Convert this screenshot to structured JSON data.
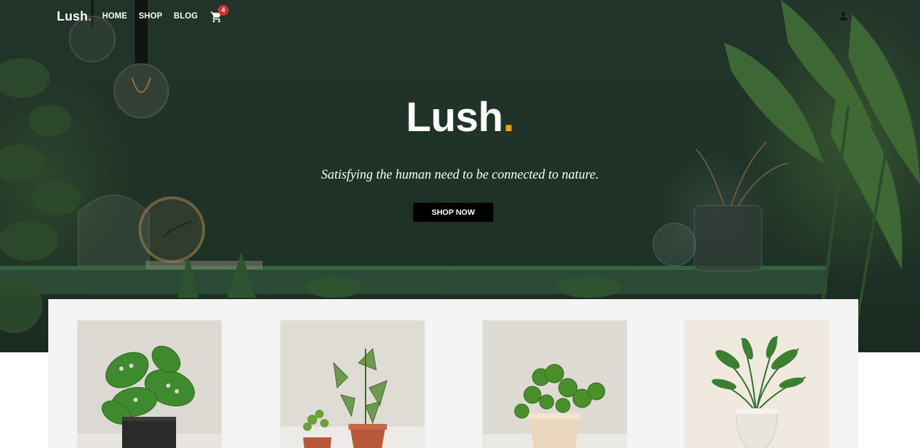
{
  "nav": {
    "logo_text": "Lush",
    "logo_dot": ".",
    "links": [
      "HOME",
      "SHOP",
      "BLOG"
    ],
    "cart_count": "4",
    "cart_icon": "cart-icon",
    "user_icon": "user-icon"
  },
  "hero": {
    "title": "Lush",
    "title_dot": ".",
    "subtitle": "Satisfying the human need to be connected to nature.",
    "button": "SHOP NOW"
  },
  "products": [
    {
      "name": "monstera-adansonii",
      "pot": "black"
    },
    {
      "name": "syngonium-and-fern",
      "pot": "terracotta"
    },
    {
      "name": "pilea-peperomioides",
      "pot": "cream"
    },
    {
      "name": "parlor-palm",
      "pot": "white"
    }
  ],
  "colors": {
    "accent": "#f5a100",
    "hero_bg": "#22342a",
    "badge": "#d32f2f",
    "button_bg": "#000000",
    "panel_bg": "#f4f4f4"
  }
}
